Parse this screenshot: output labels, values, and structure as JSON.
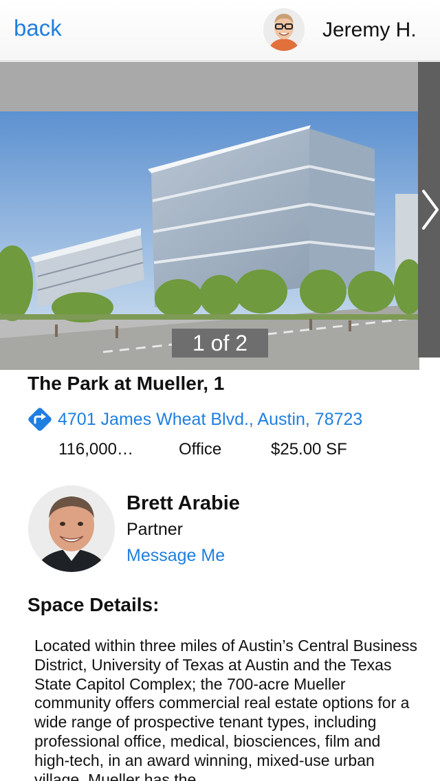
{
  "nav": {
    "back_label": "back",
    "user_name": "Jeremy H."
  },
  "gallery": {
    "counter": "1 of 2",
    "next_icon": "chevron-right-icon"
  },
  "listing": {
    "title": "The Park at Mueller, 1",
    "address": "4701 James Wheat Blvd., Austin, 78723",
    "size": "116,000…",
    "type": "Office",
    "price": "$25.00 SF"
  },
  "agent": {
    "name": "Brett Arabie",
    "role": "Partner",
    "message_label": "Message Me"
  },
  "details": {
    "heading": "Space Details:",
    "description": "Located within three miles of Austin’s Central Business District, University of Texas at Austin and the Texas State Capitol Complex; the 700-acre Mueller community offers commercial real estate options for a wide range of prospective tenant types, including professional office, medical, biosciences, film and high-tech, in an award winning, mixed-use urban village. Mueller has the"
  },
  "colors": {
    "link": "#1f7fe0",
    "gallery_bg": "#a9a9a9",
    "counter_bg": "#6e6e6e"
  }
}
